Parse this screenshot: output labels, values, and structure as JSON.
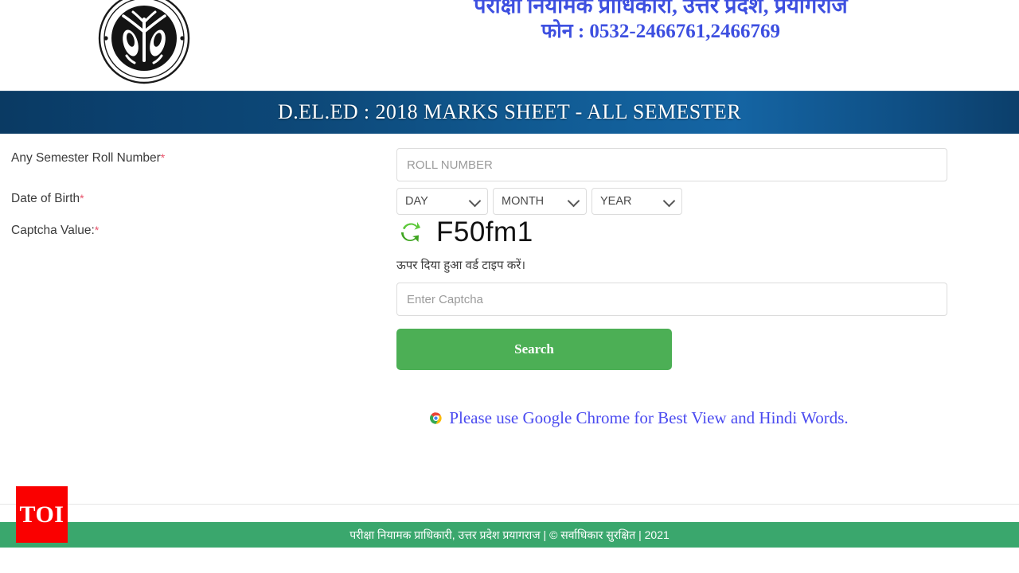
{
  "header": {
    "emblem_icon": "up-exam-authority-seal-icon",
    "org_name_hindi": "परीक्षा नियामक प्राधिकारी, उत्तर प्रदेश, प्रयागराज",
    "phone_line_hindi": "फोन : 0532-2466761,2466769",
    "text_color": "#3d4fe0"
  },
  "banner": {
    "title": "D.EL.ED : 2018 MARKS SHEET - ALL SEMESTER",
    "gradient_from": "#0a3a63",
    "gradient_to": "#1565a4"
  },
  "form": {
    "labels": {
      "roll_number": "Any Semester Roll Number",
      "date_of_birth": "Date of Birth",
      "captcha_value": "Captcha Value:",
      "required_mark": "*"
    },
    "roll_number_input": {
      "value": "",
      "placeholder": "ROLL NUMBER"
    },
    "date_of_birth": {
      "day": {
        "selected": "DAY",
        "options": [
          "DAY"
        ]
      },
      "month": {
        "selected": "MONTH",
        "options": [
          "MONTH"
        ]
      },
      "year": {
        "selected": "YEAR",
        "options": [
          "YEAR"
        ]
      },
      "caret_icon": "chevron-down-icon"
    },
    "captcha": {
      "refresh_icon": "refresh-icon",
      "code": "F50fm1",
      "hint_hindi": "ऊपर दिया हुआ वर्ड टाइप करें।",
      "input": {
        "value": "",
        "placeholder": "Enter Captcha"
      }
    },
    "search_button": {
      "label": "Search",
      "color": "#4caf55"
    }
  },
  "notice": {
    "icon": "chrome-icon",
    "text": "Please use Google Chrome for Best View and Hindi Words.",
    "color": "#4b4bf0"
  },
  "footer": {
    "text": "परीक्षा नियामक प्राधिकारी, उत्तर प्रदेश प्रयागराज | © सर्वाधिकार सुरक्षित | 2021",
    "background": "#3aa76d"
  },
  "watermark": {
    "label": "TOI",
    "background": "#fa0000"
  }
}
